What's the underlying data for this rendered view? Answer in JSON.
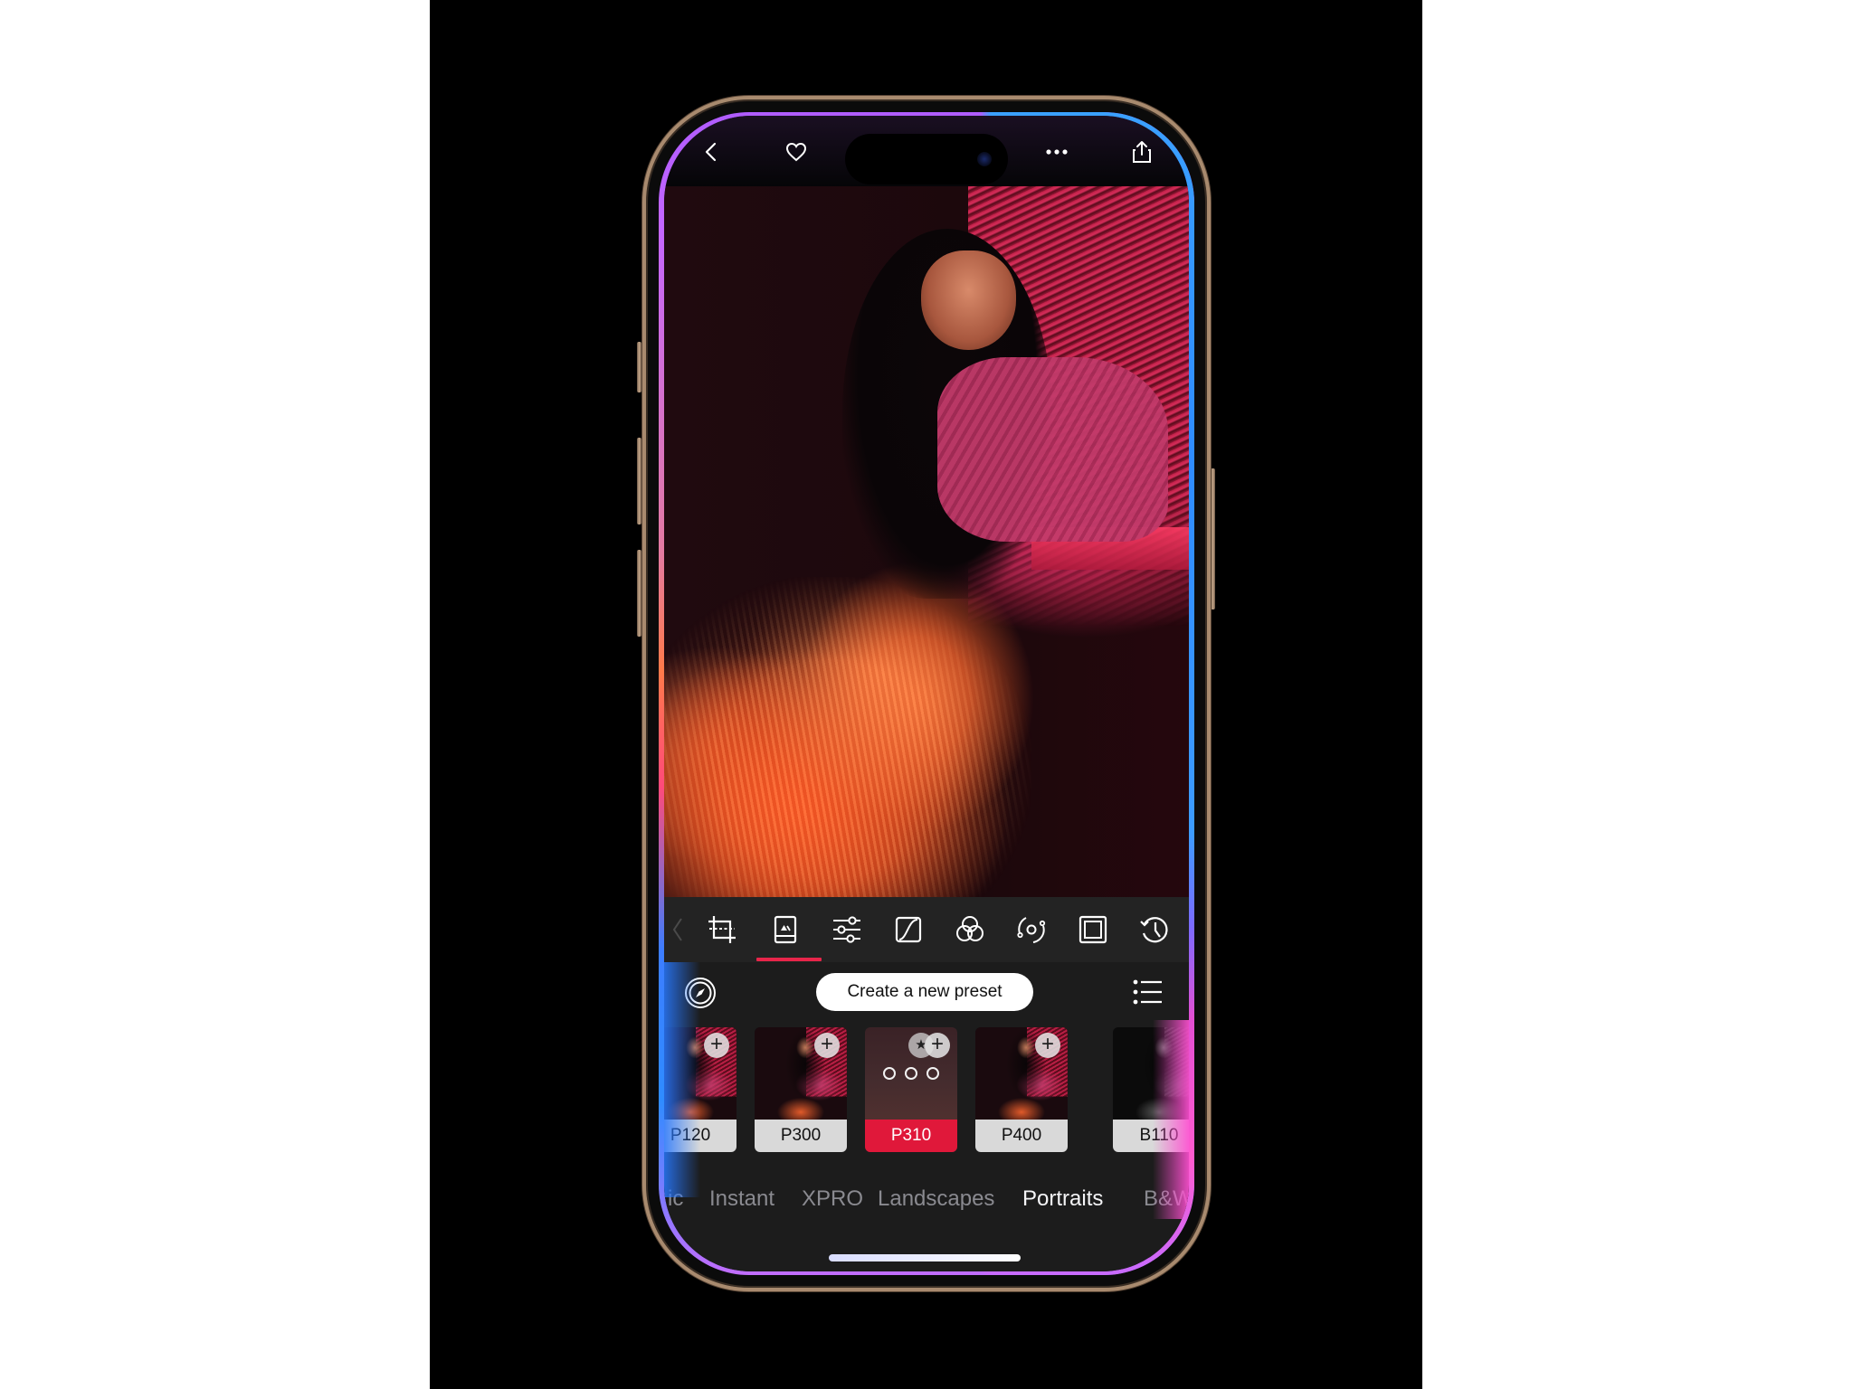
{
  "top_bar": {
    "icons": {
      "back": "chevron-left-icon",
      "favorite": "heart-icon",
      "more": "ellipsis-icon",
      "share": "share-icon"
    }
  },
  "photo": {
    "description": "Portrait of a woman in a pink jacket and orange ruffled skirt beside red window blinds"
  },
  "toolbar": {
    "tools": [
      {
        "id": "crop",
        "icon": "crop-icon"
      },
      {
        "id": "presets",
        "icon": "photo-presets-icon",
        "active": true
      },
      {
        "id": "adjust",
        "icon": "sliders-icon"
      },
      {
        "id": "curves",
        "icon": "curve-icon"
      },
      {
        "id": "color",
        "icon": "color-circles-icon"
      },
      {
        "id": "rotate",
        "icon": "orbit-icon"
      },
      {
        "id": "frame",
        "icon": "frame-icon"
      },
      {
        "id": "history",
        "icon": "history-icon"
      }
    ],
    "active_color": "#e8254a"
  },
  "presets": {
    "create_button_label": "Create a new preset",
    "items": [
      {
        "label": "P120",
        "selected": false
      },
      {
        "label": "P300",
        "selected": false
      },
      {
        "label": "P310",
        "selected": true
      },
      {
        "label": "P400",
        "selected": false
      },
      {
        "label": "B110",
        "selected": false
      }
    ],
    "add_symbol": "+",
    "selected_color": "#e0183a"
  },
  "categories": {
    "items": [
      {
        "label": "ic",
        "active": false
      },
      {
        "label": "Instant",
        "active": false
      },
      {
        "label": "XPRO",
        "active": false
      },
      {
        "label": "Landscapes",
        "active": false
      },
      {
        "label": "Portraits",
        "active": true
      },
      {
        "label": "B&W",
        "active": false
      }
    ]
  }
}
